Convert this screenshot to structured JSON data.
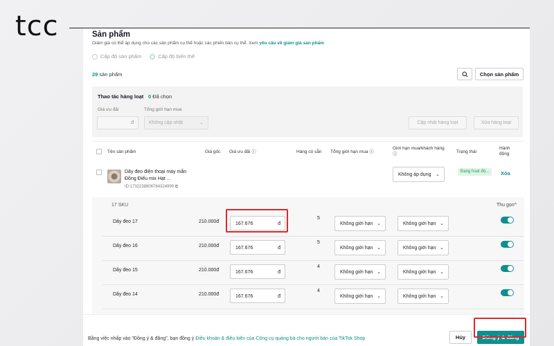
{
  "brand": {
    "logo_text": "tcc"
  },
  "section": {
    "title": "Sản phẩm",
    "description": "Giảm giá có thể áp dụng cho các sản phẩm cụ thể hoặc các phiên bản cụ thể. Xem ",
    "description_link": "yêu cầu về giảm giá sản phẩm"
  },
  "level_options": [
    "Cấp độ sản phẩm",
    "Cấp độ biến thể"
  ],
  "product_count": {
    "number": "29",
    "label": " sản phẩm"
  },
  "choose_products_label": "Chọn sản phẩm",
  "bulk": {
    "title": "Thao tác hàng loạt",
    "selected_number": "0",
    "selected_label": " Đã chọn",
    "discount_price_label": "Giá ưu đãi",
    "total_limit_label": "Tổng giới hạn mua",
    "currency": "đ",
    "limit_placeholder": "Không cập nhật",
    "update_button": "Cập nhật hàng loạt",
    "delete_button": "Xóa hàng loạt"
  },
  "table": {
    "headers": {
      "product_name": "Tên sản phẩm",
      "original_price": "Giá gốc",
      "discount_price": "Giá ưu đãi",
      "stock": "Hàng có sẵn",
      "total_limit": "Tổng giới hạn mua",
      "customer_limit": "Giới hạn mua/khách hàng",
      "status": "Trạng thái",
      "actions": "Hành động"
    },
    "product": {
      "name": "Dây đeo điện thoại may mắn Đồng Điếu mix Hạt ...",
      "id": "ID:1732238806764324999",
      "customer_limit": "Không áp dụng",
      "status": "Đang hoạt độ...",
      "delete_label": "Xóa"
    },
    "sku_count": "17 SKU",
    "collapse_label": "Thu gọn",
    "skus": [
      {
        "name": "Dây đeo 17",
        "price": "210.000đ",
        "discount": "167.676",
        "currency": "đ",
        "stock": "5",
        "total_limit": "Không giới hạn",
        "customer_limit": "Không giới hạn"
      },
      {
        "name": "Dây đeo 16",
        "price": "210.000đ",
        "discount": "167.676",
        "currency": "đ",
        "stock": "5",
        "total_limit": "Không giới hạn",
        "customer_limit": "Không giới hạn"
      },
      {
        "name": "Dây đeo 15",
        "price": "210.000đ",
        "discount": "167.676",
        "currency": "đ",
        "stock": "4",
        "total_limit": "Không giới hạn",
        "customer_limit": "Không giới hạn"
      },
      {
        "name": "Dây đeo 14",
        "price": "210.000đ",
        "discount": "167.676",
        "currency": "đ",
        "stock": "4",
        "total_limit": "Không giới hạn",
        "customer_limit": "Không giới hạn"
      }
    ]
  },
  "footer": {
    "agree_text": "Bằng việc nhấp vào \"Đồng ý & đăng\", bạn đồng ý ",
    "agree_link": "Điều khoản & điều kiện của Công cụ quảng bá cho người bán của TikTok Shop",
    "cancel_label": "Hủy",
    "publish_label": "Đồng ý & đăng"
  },
  "colors": {
    "accent": "#0f8f8f",
    "highlight": "#e0262c"
  }
}
